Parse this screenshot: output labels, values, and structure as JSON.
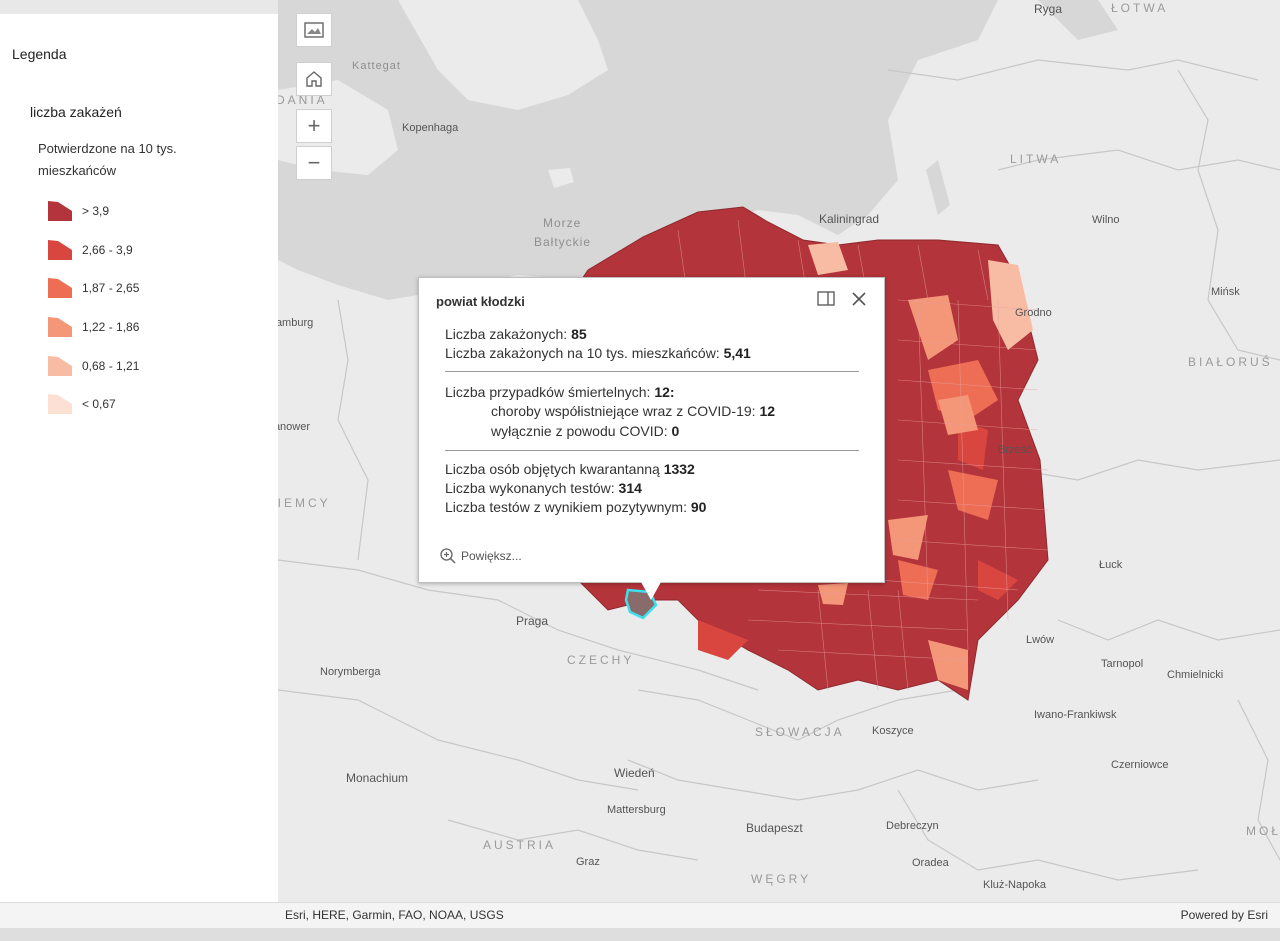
{
  "legend": {
    "title": "Legenda",
    "layer_title": "liczba zakażeń",
    "subtitle": "Potwierdzone na 10 tys. mieszkańców",
    "items": [
      {
        "label": "> 3,9",
        "color": "#b3343a"
      },
      {
        "label": "2,66 - 3,9",
        "color": "#d9463f"
      },
      {
        "label": "1,87 - 2,65",
        "color": "#ee6d55"
      },
      {
        "label": "1,22 - 1,86",
        "color": "#f49678"
      },
      {
        "label": "0,68 - 1,21",
        "color": "#f8bca4"
      },
      {
        "label": "< 0,67",
        "color": "#fde0d4"
      }
    ]
  },
  "map": {
    "buttons": {
      "basemap": "basemap-gallery-icon",
      "home": "home-icon",
      "zoom_in": "+",
      "zoom_out": "−"
    },
    "labels": {
      "ryga": "Ryga",
      "lotwa": "ŁOTWA",
      "kattegat": "Kattegat",
      "dania": "DANIA",
      "kopenhaga": "Kopenhaga",
      "litwa": "LITWA",
      "morze": "Morze",
      "baltyckie": "Bałtyckie",
      "kaliningrad": "Kaliningrad",
      "wilno": "Wilno",
      "minsk": "Mińsk",
      "grodno": "Grodno",
      "hamburg": "Hamburg",
      "bialorus": "BIAŁORUŚ",
      "hanower": "Hanower",
      "brzesc": "Brześć",
      "niemcy": "NIEMCY",
      "luck": "Łuck",
      "praga": "Praga",
      "czechy": "CZECHY",
      "lwow": "Lwów",
      "norymberga": "Norymberga",
      "tarnopol": "Tarnopol",
      "chmielnicki": "Chmielnicki",
      "iwano": "Iwano-Frankiwsk",
      "slowacja": "SŁOWACJA",
      "koszyce": "Koszyce",
      "monachium": "Monachium",
      "wieden": "Wiedeń",
      "czerniowce": "Czerniowce",
      "mattersburg": "Mattersburg",
      "budapeszt": "Budapeszt",
      "debreczyn": "Debreczyn",
      "austria": "AUSTRIA",
      "graz": "Graz",
      "oradea": "Oradea",
      "wegry": "WĘGRY",
      "kluz": "Kluż-Napoka",
      "moldawia": "MOŁD"
    }
  },
  "popup": {
    "title": "powiat kłodzki",
    "dock_icon": "dock-icon",
    "close_icon": "close-icon",
    "infected_label": "Liczba zakażonych: ",
    "infected_value": "85",
    "infected_10k_label": "Liczba zakażonych na 10 tys. mieszkańców: ",
    "infected_10k_value": "5,41",
    "deaths_label": "Liczba przypadków śmiertelnych: ",
    "deaths_value": "12:",
    "comorbid_label": "choroby współistniejące wraz z COVID-19: ",
    "comorbid_value": "12",
    "covid_only_label": "wyłącznie z powodu COVID: ",
    "covid_only_value": "0",
    "quarantine_label": "Liczba osób objętych kwarantanną ",
    "quarantine_value": "1332",
    "tests_label": "Liczba wykonanych testów: ",
    "tests_value": "314",
    "positive_label": "Liczba testów z wynikiem pozytywnym: ",
    "positive_value": "90",
    "zoom_label": "Powiększ..."
  },
  "footer": {
    "attribution": "Esri, HERE, Garmin, FAO, NOAA, USGS",
    "powered": "Powered by Esri"
  }
}
